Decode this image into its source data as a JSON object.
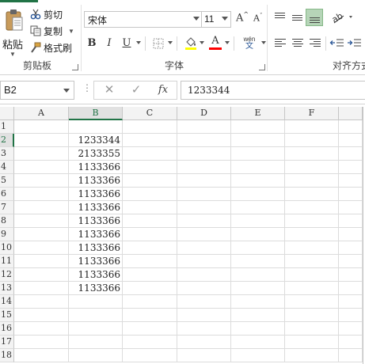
{
  "ribbon": {
    "clipboard": {
      "paste_label": "粘贴",
      "cut_label": "剪切",
      "copy_label": "复制",
      "format_painter_label": "格式刷",
      "group_label": "剪贴板"
    },
    "font": {
      "font_name": "宋体",
      "font_size": "11",
      "grow_label": "A",
      "shrink_label": "A",
      "bold_label": "B",
      "italic_label": "I",
      "underline_label": "U",
      "font_color_label": "A",
      "phonetic_label": "wén",
      "phonetic_sub": "文",
      "group_label": "字体",
      "fill_color": "#FFFF00",
      "font_color": "#FF0000"
    },
    "alignment": {
      "group_label": "对齐方式"
    }
  },
  "formula_bar": {
    "name_box": "B2",
    "dots": "⋮",
    "cancel_icon": "✕",
    "enter_icon": "✓",
    "fx_label": "fx",
    "value": "1233344"
  },
  "sheet": {
    "columns": [
      "A",
      "B",
      "C",
      "D",
      "E",
      "F"
    ],
    "rows": [
      "1",
      "2",
      "3",
      "4",
      "5",
      "6",
      "7",
      "8",
      "9",
      "10",
      "11",
      "12",
      "13",
      "14",
      "15",
      "16",
      "17",
      "18"
    ],
    "active_cell": "B2",
    "column_b_values": [
      "",
      "1233344",
      "2133355",
      "1133366",
      "1133366",
      "1133366",
      "1133366",
      "1133366",
      "1133366",
      "1133366",
      "1133366",
      "1133366",
      "1133366",
      "",
      "",
      "",
      "",
      ""
    ]
  },
  "colors": {
    "accent": "#217346",
    "header_bg": "#F3F3F3",
    "gridline": "#DCDCDC"
  }
}
